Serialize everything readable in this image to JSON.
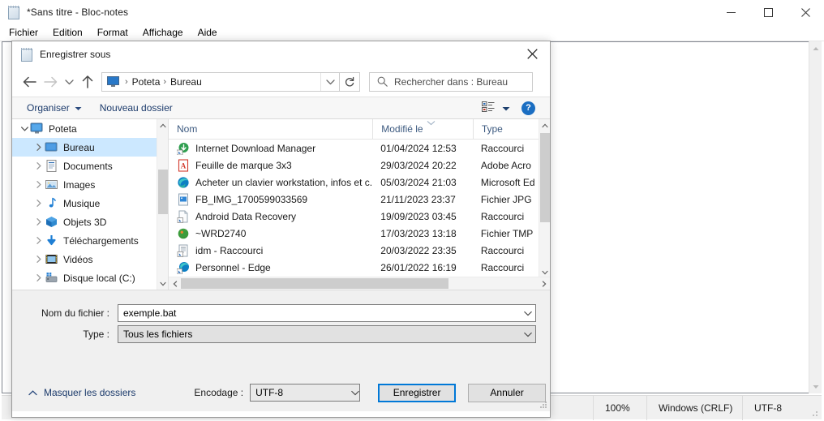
{
  "notepad": {
    "title": "*Sans titre - Bloc-notes",
    "title_icon": "notepad-icon",
    "menus": [
      "Fichier",
      "Edition",
      "Format",
      "Affichage",
      "Aide"
    ],
    "window_controls": {
      "minimize": "minimize-icon",
      "maximize": "maximize-icon",
      "close": "close-icon"
    },
    "status": {
      "zoom": "100%",
      "line_ending": "Windows (CRLF)",
      "encoding": "UTF-8"
    }
  },
  "dialog": {
    "title": "Enregistrer sous",
    "title_icon": "notepad-icon",
    "close_label": "close-icon",
    "nav": {
      "back": "back-arrow-icon",
      "forward": "forward-arrow-icon",
      "recent": "chevron-down-icon",
      "up": "up-arrow-icon",
      "breadcrumb": [
        "Poteta",
        "Bureau"
      ],
      "breadcrumb_icon": "this-pc-icon",
      "breadcrumb_dropdown": "chevron-down-icon",
      "refresh": "refresh-icon"
    },
    "search": {
      "placeholder": "Rechercher dans : Bureau",
      "value": "",
      "icon": "search-icon"
    },
    "commandbar": {
      "organize": "Organiser",
      "new_folder": "Nouveau dossier",
      "view_icon": "view-list-icon",
      "view_caret": "chevron-down-icon",
      "help": "?"
    },
    "tree": {
      "items": [
        {
          "label": "Poteta",
          "level": 0,
          "icon": "pc-icon",
          "expander": "chevron-down",
          "selected": false
        },
        {
          "label": "Bureau",
          "level": 1,
          "icon": "desktop-icon",
          "expander": "chevron-right",
          "selected": true
        },
        {
          "label": "Documents",
          "level": 1,
          "icon": "documents-icon",
          "expander": "chevron-right",
          "selected": false
        },
        {
          "label": "Images",
          "level": 1,
          "icon": "pictures-icon",
          "expander": "chevron-right",
          "selected": false
        },
        {
          "label": "Musique",
          "level": 1,
          "icon": "music-icon",
          "expander": "chevron-right",
          "selected": false
        },
        {
          "label": "Objets 3D",
          "level": 1,
          "icon": "objects3d-icon",
          "expander": "chevron-right",
          "selected": false
        },
        {
          "label": "Téléchargements",
          "level": 1,
          "icon": "downloads-icon",
          "expander": "chevron-right",
          "selected": false
        },
        {
          "label": "Vidéos",
          "level": 1,
          "icon": "videos-icon",
          "expander": "chevron-right",
          "selected": false
        },
        {
          "label": "Disque local (C:)",
          "level": 1,
          "icon": "drive-icon",
          "expander": "chevron-right",
          "selected": false
        }
      ]
    },
    "filelist": {
      "columns": [
        "Nom",
        "Modifié le",
        "Type"
      ],
      "sort_indicator": "chevron-up-small",
      "rows": [
        {
          "name": "Internet Download Manager",
          "modified": "01/04/2024 12:53",
          "type": "Raccourci",
          "icon": "idm-shortcut-icon"
        },
        {
          "name": "Feuille de marque 3x3",
          "modified": "29/03/2024 20:22",
          "type": "Adobe Acro",
          "icon": "pdf-icon"
        },
        {
          "name": "Acheter un clavier workstation, infos et c...",
          "modified": "05/03/2024 21:03",
          "type": "Microsoft Ed",
          "icon": "edge-icon"
        },
        {
          "name": "FB_IMG_1700599033569",
          "modified": "21/11/2023 23:37",
          "type": "Fichier JPG",
          "icon": "jpg-icon"
        },
        {
          "name": "Android Data Recovery",
          "modified": "19/09/2023 03:45",
          "type": "Raccourci",
          "icon": "generic-shortcut-icon"
        },
        {
          "name": "~WRD2740",
          "modified": "17/03/2023 13:18",
          "type": "Fichier TMP",
          "icon": "tmp-icon"
        },
        {
          "name": "idm - Raccourci",
          "modified": "20/03/2022 23:35",
          "type": "Raccourci",
          "icon": "idm-doc-shortcut-icon"
        },
        {
          "name": "Personnel - Edge",
          "modified": "26/01/2022 16:19",
          "type": "Raccourci",
          "icon": "edge-shortcut-icon"
        }
      ]
    },
    "form": {
      "filename_label": "Nom du fichier :",
      "filename_value": "exemple.bat",
      "type_label": "Type :",
      "type_value": "Tous les fichiers",
      "dropdown_icon": "chevron-down-icon"
    },
    "footer": {
      "hide_folders": "Masquer les dossiers",
      "hide_folders_icon": "chevron-up-icon",
      "encoding_label": "Encodage :",
      "encoding_value": "UTF-8",
      "save_button": "Enregistrer",
      "cancel_button": "Annuler"
    }
  },
  "colors": {
    "accent": "#0078d7",
    "selection": "#cce8ff",
    "link": "#1b3a6b",
    "header_text": "#3d5a80",
    "dialog_bg": "#f0f0f0"
  }
}
